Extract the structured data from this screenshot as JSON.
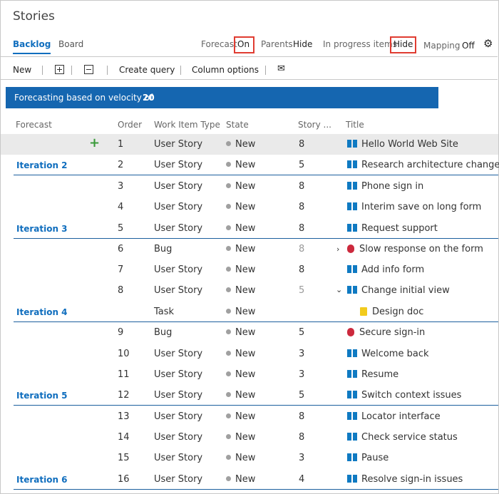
{
  "page": {
    "title": "Stories"
  },
  "tabs": {
    "backlog": "Backlog",
    "board": "Board"
  },
  "options": {
    "forecast_label": "Forecast",
    "forecast_value": "On",
    "parents_label": "Parents",
    "parents_value": "Hide",
    "inprogress_label": "In progress items",
    "inprogress_value": "Hide",
    "mapping_label": "Mapping",
    "mapping_value": "Off"
  },
  "toolbar": {
    "new": "New",
    "create_query": "Create query",
    "column_options": "Column options"
  },
  "banner": {
    "text": "Forecasting based on velocity of",
    "velocity": "20"
  },
  "columns": {
    "forecast": "Forecast",
    "order": "Order",
    "type": "Work Item Type",
    "state": "State",
    "points": "Story ...",
    "title": "Title"
  },
  "iterations": [
    "Iteration 2",
    "Iteration 3",
    "Iteration 4",
    "Iteration 5",
    "Iteration 6"
  ],
  "rows": [
    {
      "order": "1",
      "type": "User Story",
      "state": "New",
      "points": "8",
      "title": "Hello World Web Site"
    },
    {
      "order": "2",
      "type": "User Story",
      "state": "New",
      "points": "5",
      "title": "Research architecture changes"
    },
    {
      "order": "3",
      "type": "User Story",
      "state": "New",
      "points": "8",
      "title": "Phone sign in"
    },
    {
      "order": "4",
      "type": "User Story",
      "state": "New",
      "points": "8",
      "title": "Interim save on long form"
    },
    {
      "order": "5",
      "type": "User Story",
      "state": "New",
      "points": "8",
      "title": "Request support"
    },
    {
      "order": "6",
      "type": "Bug",
      "state": "New",
      "points": "8",
      "title": "Slow response on the form"
    },
    {
      "order": "7",
      "type": "User Story",
      "state": "New",
      "points": "8",
      "title": "Add info form"
    },
    {
      "order": "8",
      "type": "User Story",
      "state": "New",
      "points": "5",
      "title": "Change initial view"
    },
    {
      "order": "",
      "type": "Task",
      "state": "New",
      "points": "",
      "title": "Design doc"
    },
    {
      "order": "9",
      "type": "Bug",
      "state": "New",
      "points": "5",
      "title": "Secure sign-in"
    },
    {
      "order": "10",
      "type": "User Story",
      "state": "New",
      "points": "3",
      "title": "Welcome back"
    },
    {
      "order": "11",
      "type": "User Story",
      "state": "New",
      "points": "3",
      "title": "Resume"
    },
    {
      "order": "12",
      "type": "User Story",
      "state": "New",
      "points": "5",
      "title": "Switch context issues"
    },
    {
      "order": "13",
      "type": "User Story",
      "state": "New",
      "points": "8",
      "title": "Locator interface"
    },
    {
      "order": "14",
      "type": "User Story",
      "state": "New",
      "points": "8",
      "title": "Check service status"
    },
    {
      "order": "15",
      "type": "User Story",
      "state": "New",
      "points": "3",
      "title": "Pause"
    },
    {
      "order": "16",
      "type": "User Story",
      "state": "New",
      "points": "4",
      "title": "Resolve sign-in issues"
    }
  ]
}
